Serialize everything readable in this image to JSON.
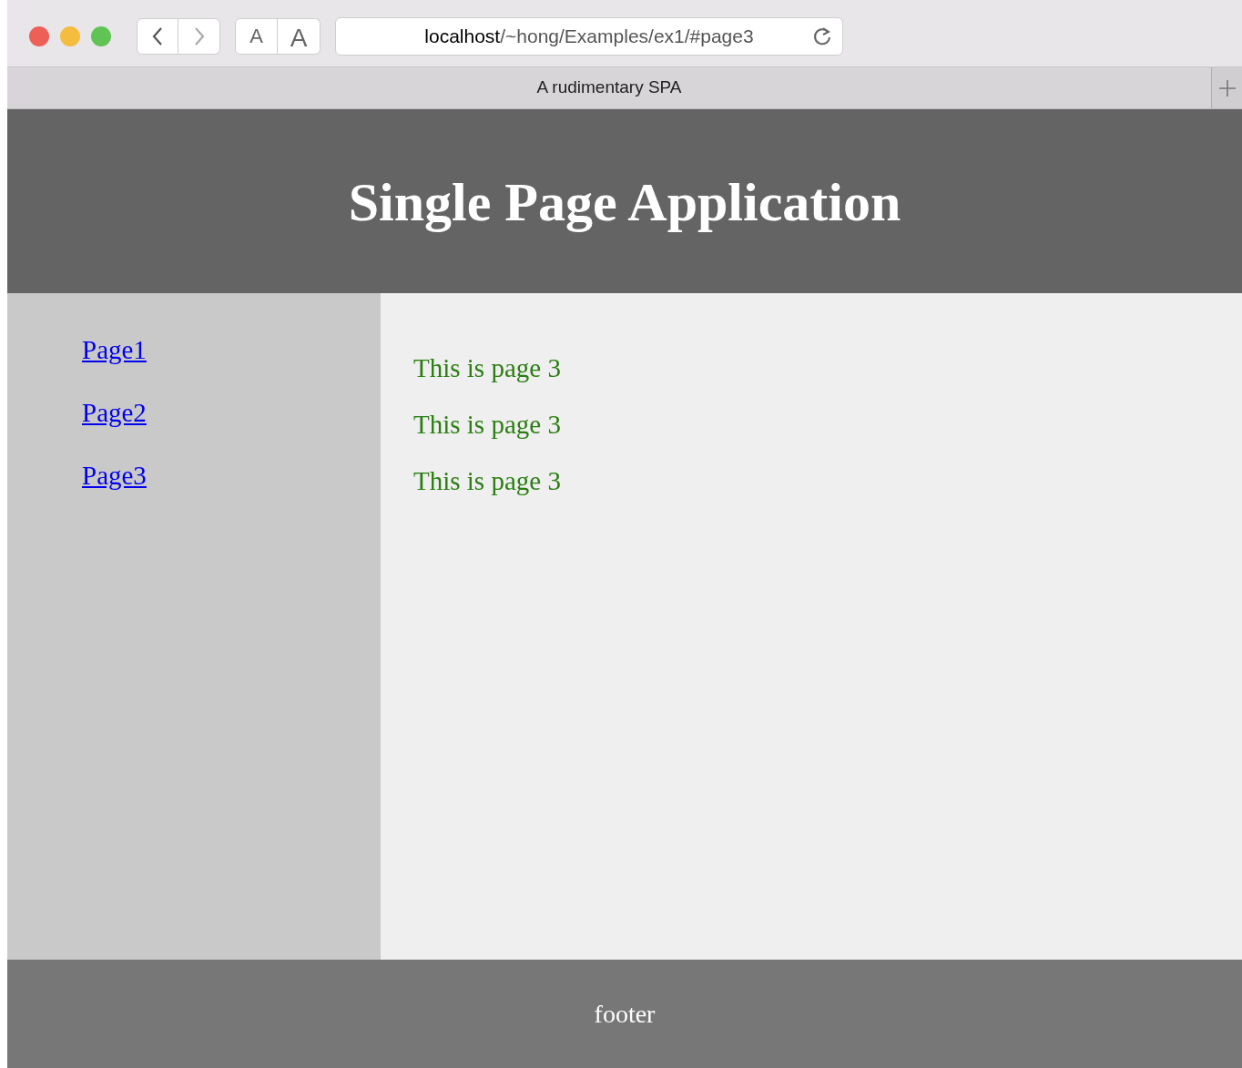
{
  "toolbar": {
    "text_size_buttons": [
      "A",
      "A"
    ],
    "address": {
      "host": "localhost",
      "path": "/~hong/Examples/ex1/#page3"
    }
  },
  "tab": {
    "title": "A rudimentary SPA"
  },
  "header": {
    "title": "Single Page Application"
  },
  "sidebar": {
    "links": [
      {
        "label": "Page1"
      },
      {
        "label": "Page2"
      },
      {
        "label": "Page3"
      }
    ]
  },
  "content": {
    "lines": [
      "This is page 3",
      "This is page 3",
      "This is page 3"
    ]
  },
  "footer": {
    "text": "footer"
  }
}
